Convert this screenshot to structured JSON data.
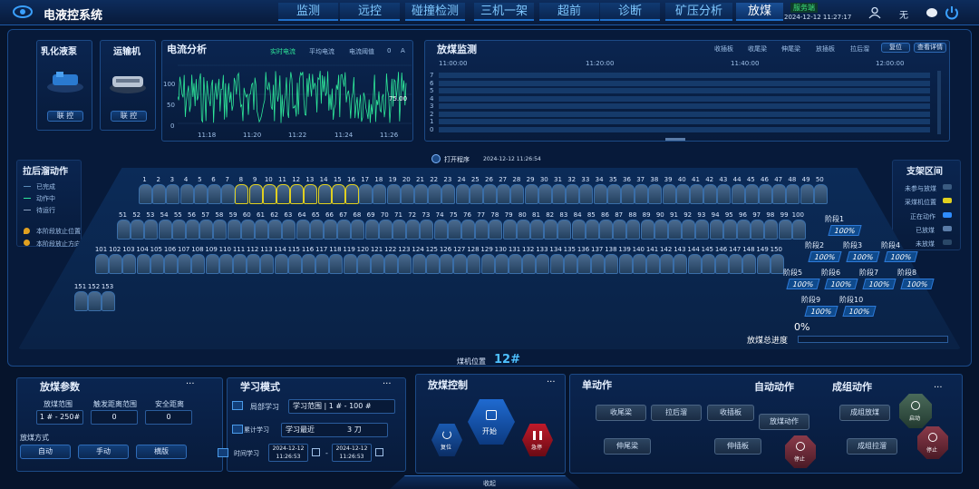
{
  "app": {
    "title": "电液控系统",
    "server_badge": "服务端",
    "datetime": "2024-12-12 11:27:17",
    "user_label": "无"
  },
  "tabs": [
    "监测",
    "远控",
    "碰撞检测",
    "三机一架",
    "超前",
    "诊断",
    "矿压分析",
    "放煤"
  ],
  "pump": {
    "title": "乳化液泵",
    "btn": "联 控"
  },
  "conveyor": {
    "title": "运输机",
    "btn": "联 控"
  },
  "current": {
    "title": "电流分析",
    "legend": [
      "实时电流",
      "平均电流",
      "电流阈值"
    ],
    "threshold_val": "0",
    "unit": "A",
    "y_ticks": [
      "100",
      "50",
      "0"
    ],
    "x_ticks": [
      "11:18",
      "11:20",
      "11:22",
      "11:24",
      "11:26"
    ],
    "value_label": "75.00"
  },
  "monitor": {
    "title": "放煤监测",
    "legend": [
      "收插板",
      "收尾梁",
      "伸尾梁",
      "放插板",
      "拉后溜"
    ],
    "reset": "复位",
    "detail": "查看详情",
    "times": [
      "11:00:00",
      "11:20:00",
      "11:40:00",
      "12:00:00"
    ],
    "rows": [
      "7",
      "6",
      "5",
      "4",
      "3",
      "2",
      "1",
      "0"
    ]
  },
  "program": {
    "label": "打开程序",
    "time": "2024-12-12 11:26:54"
  },
  "left_legend": {
    "title": "拉后溜动作",
    "items": [
      "已完成",
      "动作中",
      "待运行"
    ],
    "pos1": "本阶段放止位置",
    "pos2": "本阶段放止方向"
  },
  "right_legend": {
    "title": "支架区间",
    "items": [
      "未参与放煤",
      "采煤机位置",
      "正在动作",
      "已放煤",
      "未放煤"
    ]
  },
  "rows": {
    "row1": {
      "start": 1,
      "end": 50
    },
    "row2": {
      "start": 51,
      "end": 100
    },
    "row3": {
      "start": 101,
      "end": 150
    },
    "row4": [
      "151",
      "152",
      "153"
    ]
  },
  "stages": [
    {
      "name": "阶段1",
      "pct": "100%"
    },
    {
      "name": "阶段2",
      "pct": "100%"
    },
    {
      "name": "阶段3",
      "pct": "100%"
    },
    {
      "name": "阶段4",
      "pct": "100%"
    },
    {
      "name": "阶段5",
      "pct": "100%"
    },
    {
      "name": "阶段6",
      "pct": "100%"
    },
    {
      "name": "阶段7",
      "pct": "100%"
    },
    {
      "name": "阶段8",
      "pct": "100%"
    },
    {
      "name": "阶段9",
      "pct": "100%"
    },
    {
      "name": "阶段10",
      "pct": "100%"
    }
  ],
  "progress": {
    "label": "放煤总进度",
    "value": "0%",
    "fraction": 0
  },
  "coal_pos": {
    "label": "煤机位置",
    "value": "12#"
  },
  "params": {
    "title": "放煤参数",
    "headers": [
      "放煤范围",
      "触发距离范围",
      "安全距离"
    ],
    "values": [
      "1 # - 250#",
      "0",
      "0"
    ],
    "mode_label": "放煤方式",
    "modes": [
      "自动",
      "手动",
      "横版"
    ]
  },
  "learn": {
    "title": "学习模式",
    "rows": [
      {
        "label": "局部学习",
        "field": "学习范围",
        "value": "1 # - 100 #"
      },
      {
        "label": "累计学习",
        "field": "学习最近",
        "value": "3 刀"
      },
      {
        "label": "时间学习",
        "d1": "2024-12-12",
        "t1": "11:26:53",
        "sep": "-",
        "d2": "2024-12-12",
        "t2": "11:26:53"
      }
    ]
  },
  "control": {
    "title": "放煤控制",
    "start": "开始",
    "reset": "复位",
    "stop": "急停"
  },
  "single": {
    "title": "单动作",
    "btns": [
      "收尾梁",
      "拉后溜",
      "收插板",
      "伸尾梁",
      "伸插板"
    ]
  },
  "auto": {
    "title": "自动动作",
    "btn": "放煤动作",
    "stop": "停止"
  },
  "group": {
    "title": "成组动作",
    "btns": [
      "成组放煤",
      "成组拉溜"
    ],
    "start": "启动",
    "stop": "停止"
  },
  "collapse": "收起",
  "colors": {
    "accent": "#2f8cff",
    "green": "#2ee89a",
    "yellow": "#e0d020"
  }
}
